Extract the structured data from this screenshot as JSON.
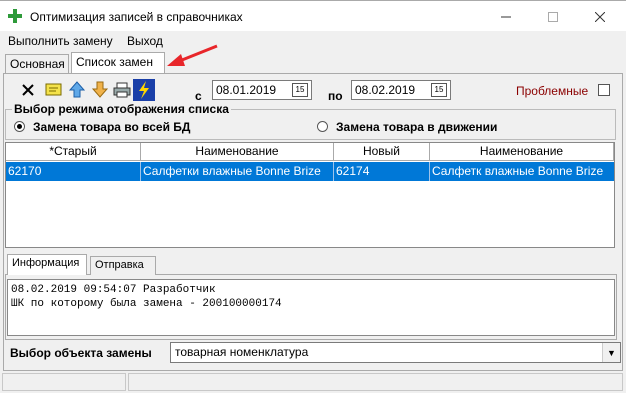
{
  "window": {
    "title": "Оптимизация записей в справочниках"
  },
  "menu": {
    "items": [
      "Выполнить замену",
      "Выход"
    ]
  },
  "tabs": [
    "Основная",
    "Список замен"
  ],
  "toolbar": {
    "date_from_label": "с",
    "date_from": "08.01.2019",
    "date_to_label": "по",
    "date_to": "08.02.2019",
    "calendar_label": "15",
    "problem_label": "Проблемные"
  },
  "mode": {
    "title": "Выбор режима отображения списка",
    "option_all": "Замена товара во всей БД",
    "option_move": "Замена товара в движении"
  },
  "table": {
    "headers": [
      "*Старый",
      "Наименование",
      "Новый",
      "Наименование"
    ],
    "rows": [
      [
        "62170",
        "Салфетки влажные Bonne Brize",
        "62174",
        "Салфетк влажные Bonne Brize"
      ]
    ]
  },
  "info_tabs": [
    "Информация",
    "Отправка"
  ],
  "info": {
    "line1": "08.02.2019 09:54:07 Разработчик",
    "line2": "ШК по которому была замена - 200100000174"
  },
  "replace_object": {
    "label": "Выбор объекта замены",
    "value": "товарная номенклатура"
  },
  "colors": {
    "selection": "#0078d7",
    "problem_text": "#8b0000",
    "annotation_arrow": "#e8262a"
  }
}
